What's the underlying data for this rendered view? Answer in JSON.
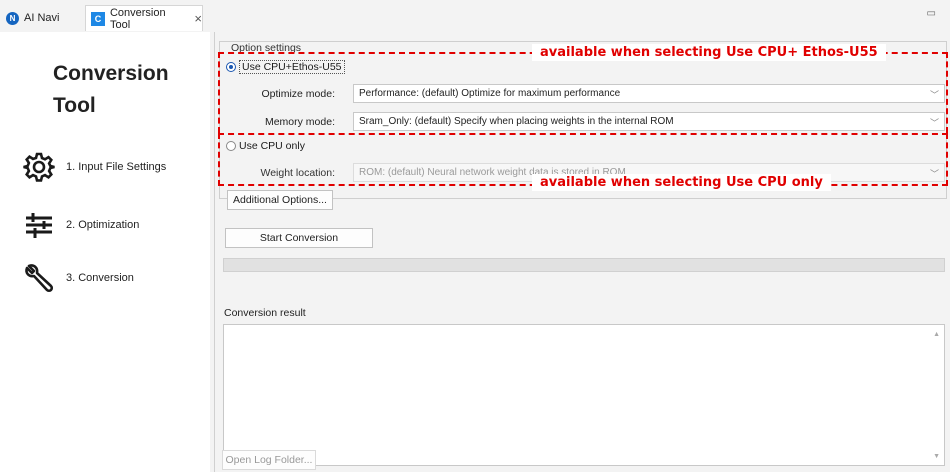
{
  "tabs": [
    {
      "label": "AI Navi",
      "icon": "ai-navi-icon"
    },
    {
      "label": "Conversion Tool",
      "icon": "conversion-tool-icon"
    }
  ],
  "tab_close": "×",
  "nav": {
    "title": "Conversion Tool",
    "items": [
      {
        "label": "1. Input File Settings",
        "icon": "gear-icon"
      },
      {
        "label": "2. Optimization",
        "icon": "sliders-icon"
      },
      {
        "label": "3. Conversion",
        "icon": "wrench-icon"
      }
    ]
  },
  "options": {
    "legend": "Option settings",
    "cpu_ethos": {
      "label": "Use CPU+Ethos-U55",
      "selected": true,
      "optimize_label": "Optimize mode:",
      "optimize_value": "Performance: (default) Optimize for maximum performance",
      "memory_label": "Memory mode:",
      "memory_value": "Sram_Only: (default) Specify when placing weights in the internal ROM"
    },
    "cpu_only": {
      "label": "Use CPU only",
      "selected": false,
      "weight_label": "Weight location:",
      "weight_value": "ROM: (default) Neural network weight data is stored in ROM"
    }
  },
  "buttons": {
    "additional": "Additional Options...",
    "start": "Start Conversion",
    "open_log": "Open Log Folder..."
  },
  "progress": {
    "value": 0
  },
  "result": {
    "label": "Conversion result",
    "value": ""
  },
  "annotations": {
    "top": "available when selecting Use CPU+ Ethos-U55",
    "bottom": "available when selecting Use CPU only",
    "color": "#e00000"
  },
  "colors": {
    "accent": "#1a56b0",
    "tab_icon": "#1e88e5"
  }
}
